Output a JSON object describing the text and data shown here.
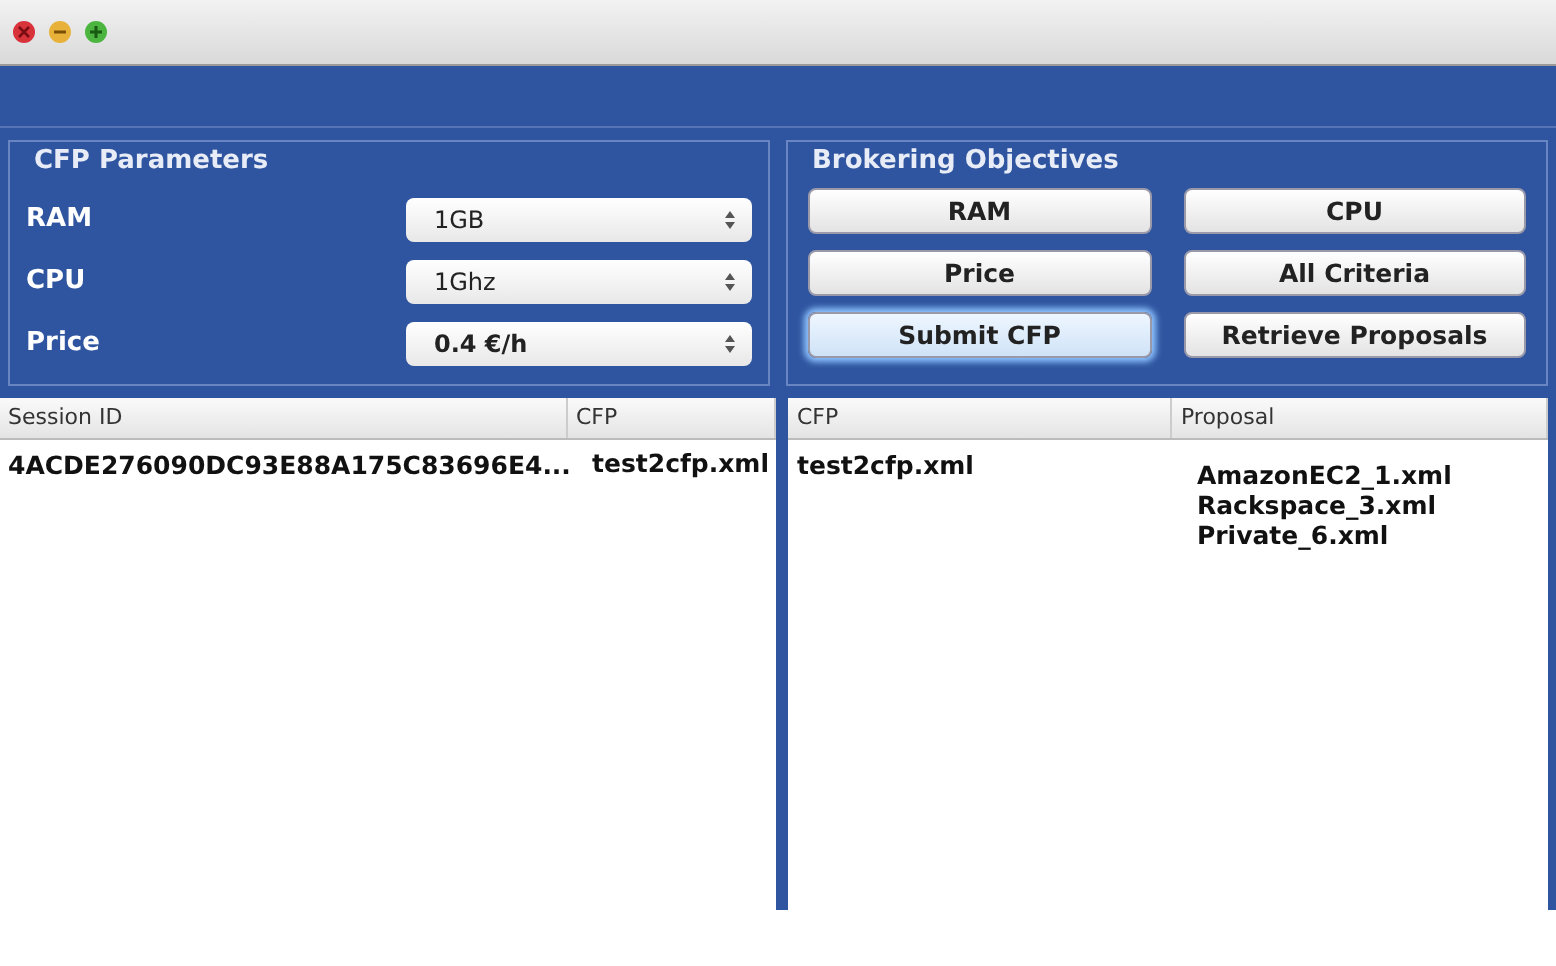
{
  "cfp_parameters": {
    "title": "CFP Parameters",
    "fields": [
      {
        "label": "RAM",
        "value": "1GB",
        "bold": false
      },
      {
        "label": "CPU",
        "value": "1Ghz",
        "bold": false
      },
      {
        "label": "Price",
        "value": "0.4 €/h",
        "bold": true
      }
    ]
  },
  "brokering_objectives": {
    "title": "Brokering Objectives",
    "buttons": [
      {
        "label": "RAM",
        "focused": false
      },
      {
        "label": "CPU",
        "focused": false
      },
      {
        "label": "Price",
        "focused": false
      },
      {
        "label": "All Criteria",
        "focused": false
      },
      {
        "label": "Submit CFP",
        "focused": true
      },
      {
        "label": "Retrieve Proposals",
        "focused": false
      }
    ]
  },
  "sessions_table": {
    "columns": [
      "Session ID",
      "CFP"
    ],
    "rows": [
      {
        "cells": [
          "4ACDE276090DC93E88A175C83696E4...",
          "test2cfp.xml"
        ]
      }
    ]
  },
  "proposals_table": {
    "columns": [
      "CFP",
      "Proposal"
    ],
    "rows": [
      {
        "cfp": "test2cfp.xml",
        "proposals": [
          "AmazonEC2_1.xml",
          "Rackspace_3.xml",
          "Private_6.xml"
        ]
      }
    ]
  }
}
